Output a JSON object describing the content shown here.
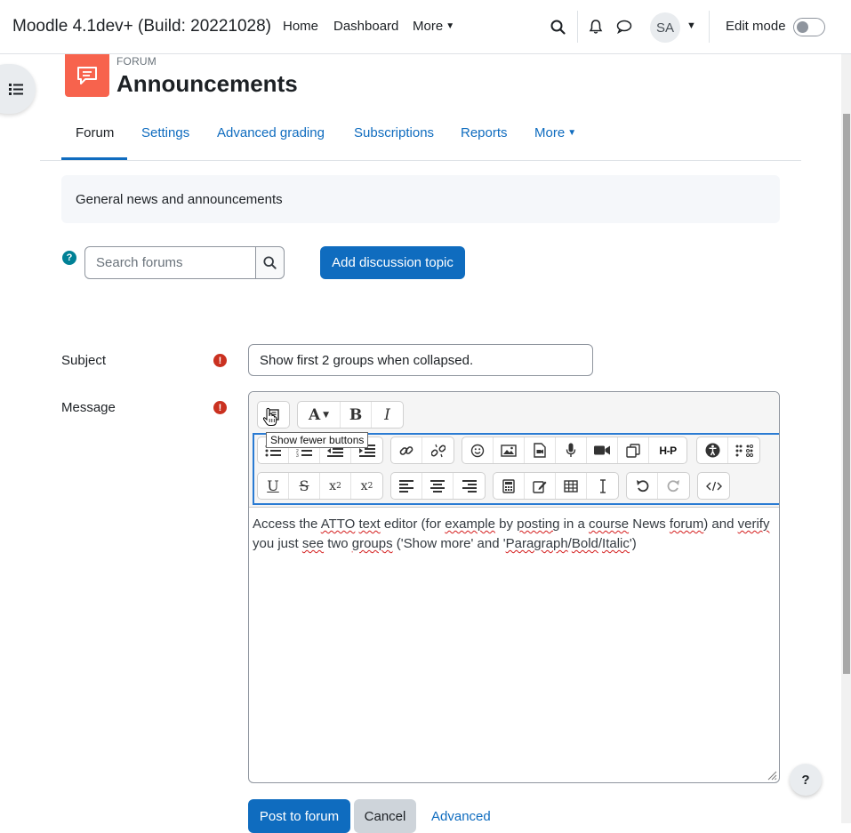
{
  "navbar": {
    "brand": "Moodle 4.1dev+ (Build: 20221028)",
    "links": [
      "Home",
      "Dashboard",
      "More"
    ],
    "user_initials": "SA",
    "edit_mode_label": "Edit mode",
    "edit_mode_on": false
  },
  "header": {
    "kicker": "FORUM",
    "title": "Announcements",
    "icon": "forum-icon",
    "icon_color": "#f7634d"
  },
  "tabs": {
    "items": [
      "Forum",
      "Settings",
      "Advanced grading",
      "Subscriptions",
      "Reports",
      "More"
    ],
    "active": "Forum"
  },
  "intro": "General news and announcements",
  "search": {
    "placeholder": "Search forums",
    "add_button": "Add discussion topic"
  },
  "form": {
    "subject_label": "Subject",
    "subject_value": "Show first 2 groups when collapsed.",
    "message_label": "Message",
    "tooltip": "Show fewer buttons",
    "message_text": {
      "line1": [
        "Access the ",
        "ATTO",
        " ",
        "text",
        " editor (for ",
        "example",
        " by ",
        "posting",
        " in a ",
        "course",
        " News ",
        "forum",
        ") and ",
        "verify"
      ],
      "line2": [
        "you just ",
        "see",
        " two ",
        "groups",
        " ('Show more' and '",
        "Paragraph",
        "/",
        "Bold",
        "/",
        "Italic",
        "')"
      ]
    },
    "post_button": "Post to forum",
    "cancel_button": "Cancel",
    "advanced_link": "Advanced"
  },
  "colors": {
    "primary": "#0f6cbf",
    "required": "#ca3120",
    "help": "#008196"
  }
}
